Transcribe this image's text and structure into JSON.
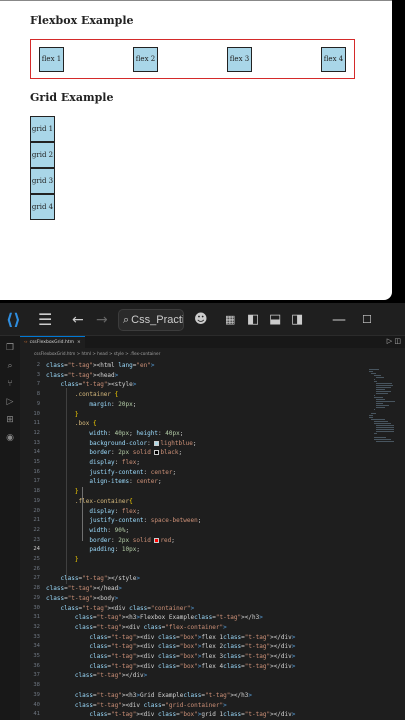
{
  "preview": {
    "flex_heading": "Flexbox Example",
    "grid_heading": "Grid Example",
    "flex_items": [
      "flex 1",
      "flex 2",
      "flex 3",
      "flex 4"
    ],
    "grid_items": [
      "grid 1",
      "grid 2",
      "grid 3",
      "grid 4"
    ]
  },
  "titlebar": {
    "search_text": "Css_Practic",
    "icons": [
      "vscode-logo-icon",
      "menu-icon",
      "back-arrow-icon",
      "forward-arrow-icon",
      "copilot-icon",
      "layout-icon",
      "panel-left-icon",
      "panel-bottom-icon",
      "panel-right-icon",
      "minimize-icon",
      "maximize-icon"
    ]
  },
  "editor": {
    "tab_label": "cssFlexboxGrid.htm",
    "breadcrumb": "cssFlexboxGrid.htm > html > head > style > .flex-container",
    "active_line": 24,
    "colors": {
      "lightblue": "#add8e6",
      "black": "#000000",
      "red": "#ff0000"
    },
    "lines": [
      {
        "n": "2",
        "code": "<html lang=\"en\">"
      },
      {
        "n": "3",
        "code": "<head>"
      },
      {
        "n": "7",
        "code": "    <style>"
      },
      {
        "n": "8",
        "code": "        .container {"
      },
      {
        "n": "9",
        "code": "            margin: 20px;"
      },
      {
        "n": "10",
        "code": "        }"
      },
      {
        "n": "11",
        "code": "        .box {"
      },
      {
        "n": "12",
        "code": "            width: 40px; height: 40px;"
      },
      {
        "n": "13",
        "code": "            background-color: lightblue;"
      },
      {
        "n": "14",
        "code": "            border: 2px solid black;"
      },
      {
        "n": "15",
        "code": "            display: flex;"
      },
      {
        "n": "16",
        "code": "            justify-content: center;"
      },
      {
        "n": "17",
        "code": "            align-items: center;"
      },
      {
        "n": "18",
        "code": "        }"
      },
      {
        "n": "19",
        "code": "        .flex-container{"
      },
      {
        "n": "20",
        "code": "            display: flex;"
      },
      {
        "n": "21",
        "code": "            justify-content: space-between;"
      },
      {
        "n": "22",
        "code": "            width: 90%;"
      },
      {
        "n": "23",
        "code": "            border: 2px solid red;"
      },
      {
        "n": "24",
        "code": "            padding: 10px;"
      },
      {
        "n": "25",
        "code": "        }"
      },
      {
        "n": "26",
        "code": ""
      },
      {
        "n": "27",
        "code": "    </style>"
      },
      {
        "n": "28",
        "code": "</head>"
      },
      {
        "n": "29",
        "code": "<body>"
      },
      {
        "n": "30",
        "code": "    <div class=\"container\">"
      },
      {
        "n": "31",
        "code": "        <h3>Flexbox Example</h3>"
      },
      {
        "n": "32",
        "code": "        <div class=\"flex-container\">"
      },
      {
        "n": "33",
        "code": "            <div class=\"box\">flex 1</div>"
      },
      {
        "n": "34",
        "code": "            <div class=\"box\">flex 2</div>"
      },
      {
        "n": "35",
        "code": "            <div class=\"box\">flex 3</div>"
      },
      {
        "n": "36",
        "code": "            <div class=\"box\">flex 4</div>"
      },
      {
        "n": "37",
        "code": "        </div>"
      },
      {
        "n": "38",
        "code": ""
      },
      {
        "n": "39",
        "code": "        <h3>Grid Example</h3>"
      },
      {
        "n": "40",
        "code": "        <div class=\"grid-container\">"
      },
      {
        "n": "41",
        "code": "            <div class=\"box\">grid 1</div>"
      }
    ]
  }
}
